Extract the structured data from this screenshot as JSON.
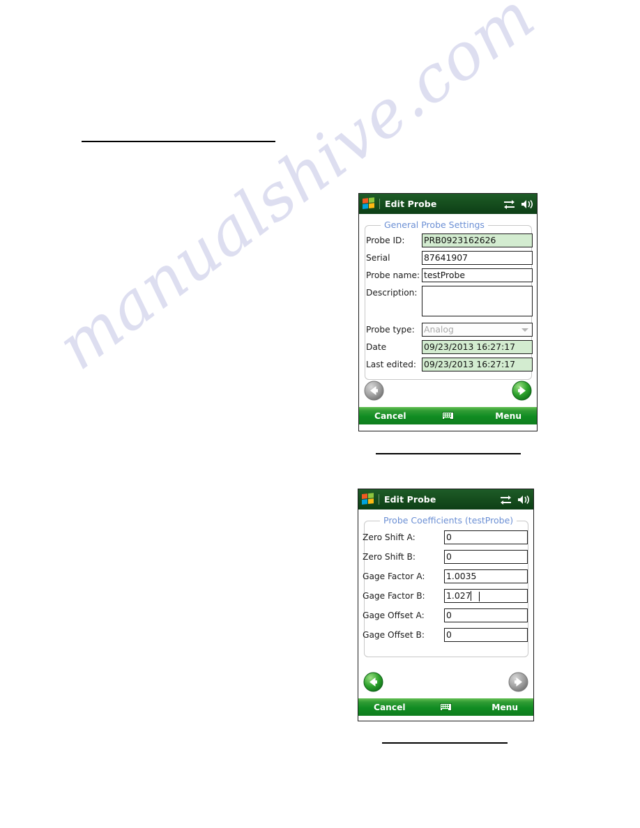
{
  "page": {
    "watermark": "manualshive.com",
    "background_color": "#ffffff",
    "rule_color": "#000000"
  },
  "rules": [
    {
      "name": "top-rule"
    },
    {
      "name": "middle-rule"
    },
    {
      "name": "bottom-rule"
    }
  ],
  "colors": {
    "titlebar_green": "#0d3f16",
    "softbar_green": "#108c22",
    "legend_blue": "#6b8fd4",
    "readonly_field_green": "#d3ecd0",
    "disabled_text_gray": "#a9a9a9",
    "arrow_enabled_green": "#19a02a",
    "arrow_disabled_gray": "#a0a0a0"
  },
  "screens": [
    {
      "id": "general-probe-settings",
      "titlebar": {
        "title": "Edit Probe",
        "logo": "windows-mobile-logo",
        "icons": [
          "connectivity-icon",
          "volume-icon"
        ]
      },
      "group": {
        "legend": "General Probe Settings"
      },
      "fields": [
        {
          "label": "Probe ID:",
          "value": "PRB0923162626",
          "state": "readonly",
          "type": "text"
        },
        {
          "label": "Serial",
          "value": "87641907",
          "state": "editable",
          "type": "text"
        },
        {
          "label": "Probe name:",
          "value": "testProbe",
          "state": "editable",
          "type": "text"
        },
        {
          "label": "Description:",
          "value": "",
          "state": "editable",
          "type": "textarea"
        },
        {
          "label": "Probe type:",
          "value": "Analog",
          "state": "disabled",
          "type": "combo"
        },
        {
          "label": "Date",
          "value": "09/23/2013 16:27:17",
          "state": "readonly",
          "type": "text"
        },
        {
          "label": "Last edited:",
          "value": "09/23/2013 16:27:17",
          "state": "readonly",
          "type": "text"
        }
      ],
      "nav": {
        "back": {
          "icon": "arrow-left-icon",
          "enabled": false
        },
        "next": {
          "icon": "arrow-right-icon",
          "enabled": true
        }
      },
      "softbar": {
        "left_label": "Cancel",
        "sip_icon": "keyboard-icon",
        "right_label": "Menu"
      }
    },
    {
      "id": "probe-coefficients",
      "titlebar": {
        "title": "Edit Probe",
        "logo": "windows-mobile-logo",
        "icons": [
          "connectivity-icon",
          "volume-icon"
        ]
      },
      "group": {
        "legend": "Probe Coefficients (testProbe)"
      },
      "fields": [
        {
          "label": "Zero Shift A:",
          "value": "0",
          "state": "editable",
          "type": "text"
        },
        {
          "label": "Zero Shift B:",
          "value": "0",
          "state": "editable",
          "type": "text"
        },
        {
          "label": "Gage Factor A:",
          "value": "1.0035",
          "state": "editable",
          "type": "text"
        },
        {
          "label": "Gage Factor B:",
          "value": "1.027",
          "state": "focused",
          "type": "text"
        },
        {
          "label": "Gage Offset A:",
          "value": "0",
          "state": "editable",
          "type": "text"
        },
        {
          "label": "Gage Offset B:",
          "value": "0",
          "state": "editable",
          "type": "text"
        }
      ],
      "nav": {
        "back": {
          "icon": "arrow-left-icon",
          "enabled": true
        },
        "next": {
          "icon": "arrow-right-icon",
          "enabled": false
        }
      },
      "softbar": {
        "left_label": "Cancel",
        "sip_icon": "keyboard-icon",
        "right_label": "Menu"
      }
    }
  ]
}
